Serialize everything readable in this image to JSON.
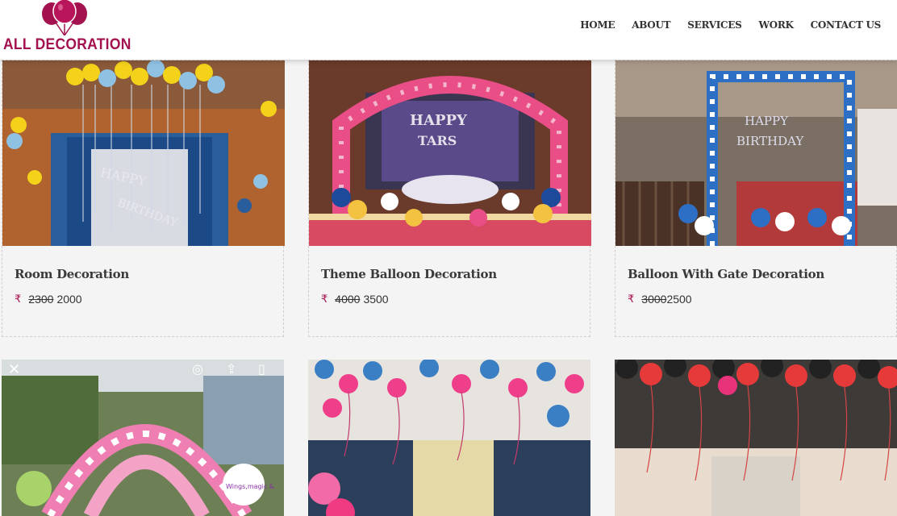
{
  "brand": {
    "name": "ALL DECORATION",
    "color": "#a3124f"
  },
  "nav": {
    "items": [
      {
        "label": "HOME"
      },
      {
        "label": "ABOUT"
      },
      {
        "label": "SERVICES"
      },
      {
        "label": "WORK"
      },
      {
        "label": "CONTACT US"
      }
    ]
  },
  "cards": [
    {
      "title": "Room Decoration",
      "currency": "₹",
      "old_price": "2300",
      "price": "2000"
    },
    {
      "title": "Theme Balloon Decoration",
      "currency": "₹",
      "old_price": "4000",
      "price": "3500"
    },
    {
      "title": "Balloon With Gate Decoration",
      "currency": "₹",
      "old_price": "3000",
      "price": "2500"
    }
  ],
  "overlay_icons": [
    "close-icon",
    "lens-icon",
    "share-icon",
    "bookmark-icon"
  ]
}
